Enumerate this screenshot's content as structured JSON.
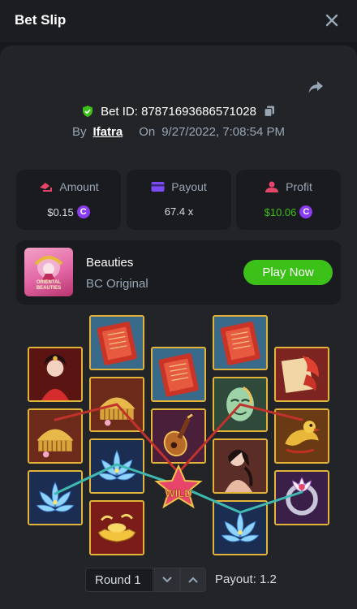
{
  "header": {
    "title": "Bet Slip"
  },
  "bet": {
    "id_label": "Bet ID: 8787169368657102​8",
    "by_label": "By",
    "user": "Ifatra",
    "on_label": "On",
    "datetime": "9/27/2022, 7:08:54 PM"
  },
  "stats": {
    "amount": {
      "label": "Amount",
      "value": "$0.15"
    },
    "payout": {
      "label": "Payout",
      "value": "67.4 x"
    },
    "profit": {
      "label": "Profit",
      "value": "$10.06"
    }
  },
  "game": {
    "name": "Beauties",
    "provider": "BC Original",
    "play_label": "Play Now",
    "thumb_text_1": "ORIENTAL",
    "thumb_text_2": "BEAUTIES"
  },
  "reels": {
    "win_text": "WILD",
    "tiles": [
      {
        "col": 0,
        "row": 0,
        "symbol": "lady-red"
      },
      {
        "col": 0,
        "row": 1,
        "symbol": "gold-comb"
      },
      {
        "col": 0,
        "row": 2,
        "symbol": "blue-lotus"
      },
      {
        "col": 1,
        "row": 0,
        "symbol": "red-fan"
      },
      {
        "col": 1,
        "row": 1,
        "symbol": "gold-comb"
      },
      {
        "col": 1,
        "row": 2,
        "symbol": "blue-lotus"
      },
      {
        "col": 1,
        "row": 3,
        "symbol": "gold-ingot"
      },
      {
        "col": 2,
        "row": 0,
        "symbol": "red-fan"
      },
      {
        "col": 2,
        "row": 1,
        "symbol": "pipa-lute"
      },
      {
        "col": 2,
        "row": 2,
        "symbol": "wild-star"
      },
      {
        "col": 3,
        "row": 0,
        "symbol": "red-fan"
      },
      {
        "col": 3,
        "row": 1,
        "symbol": "jade-mask"
      },
      {
        "col": 3,
        "row": 2,
        "symbol": "lady-dark"
      },
      {
        "col": 3,
        "row": 3,
        "symbol": "blue-lotus"
      },
      {
        "col": 4,
        "row": 0,
        "symbol": "koi-scroll"
      },
      {
        "col": 4,
        "row": 1,
        "symbol": "gold-bird"
      },
      {
        "col": 4,
        "row": 2,
        "symbol": "lotus-ring"
      }
    ]
  },
  "round": {
    "label": "Round 1"
  },
  "result": {
    "payout": "Payout: 1.2"
  },
  "colors": {
    "background": "#17181b",
    "card": "#1a1b1f",
    "muted_text": "#98a7b5",
    "profit_green": "#3bc117",
    "play_button": "#3bc117",
    "coin_purple": "#8a3cf0",
    "tile_border": "#e2b43a",
    "payline_red": "#c0322b",
    "payline_teal": "#3fb8b0"
  }
}
